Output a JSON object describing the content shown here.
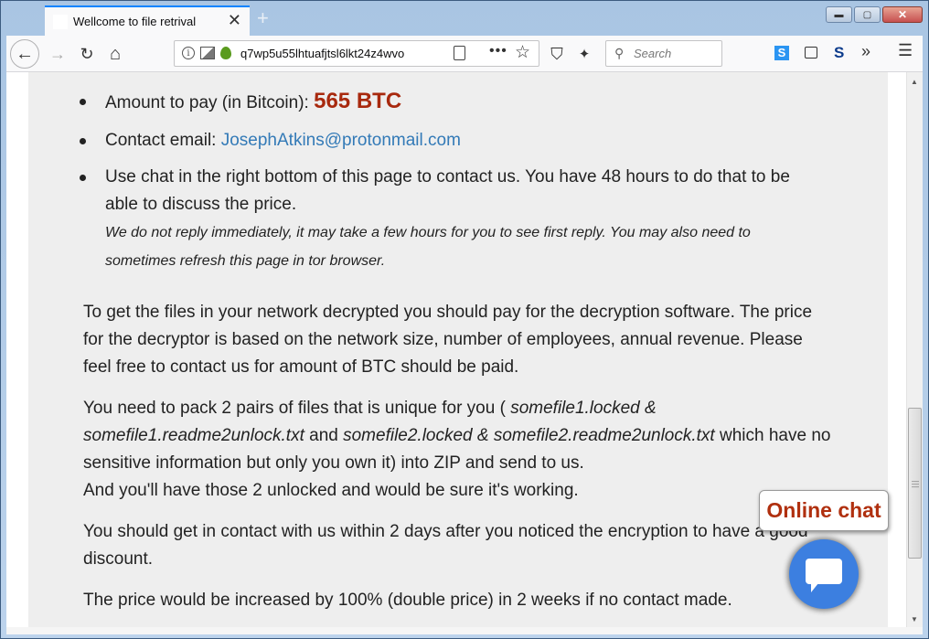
{
  "browser": {
    "tab_title": "Wellcome to file retrival",
    "tab_close": "✕",
    "new_tab": "+",
    "url": "q7wp5u55lhtuafjtsl6lkt24z4wvo",
    "search_placeholder": "Search",
    "window_buttons": {
      "minimize": "▬",
      "maximize": "▢",
      "close": "✕"
    },
    "icons": {
      "back": "←",
      "forward": "→",
      "reload": "↻",
      "home": "⌂",
      "more": "•••",
      "star": "☆",
      "shield": "⛉",
      "magic": "✦",
      "search": "⚲",
      "s1": "S",
      "s2": "S",
      "overflow": "»",
      "menu": "☰",
      "info": "i"
    }
  },
  "page": {
    "bullets": {
      "amount_label": "Amount to pay (in Bitcoin): ",
      "amount_value": "565 BTC",
      "email_label": "Contact email: ",
      "email_value": "JosephAtkins@protonmail.com",
      "chat_text": "Use chat in the right bottom of this page to contact us. You have 48 hours to do that to be able to discuss the price.",
      "chat_note": "We do not reply immediately, it may take a few hours for you to see first reply. You may also need to sometimes refresh this page in tor browser."
    },
    "paragraphs": {
      "p1": "To get the files in your network decrypted you should pay for the decryption software. The price for the decryptor is based on the network size, number of employees, annual revenue. Please feel free to contact us for amount of BTC should be paid.",
      "p2_a": "You need to pack 2 pairs of files that is unique for you ( ",
      "p2_f1": "somefile1.locked & somefile1.readme2unlock.txt",
      "p2_and": " and ",
      "p2_f2": "somefile2.locked & somefile2.readme2unlock.txt",
      "p2_b": " which have no sensitive information but only you own it) into ZIP and send to us.",
      "p2_c": "And you'll have those 2 unlocked and would be sure it's working.",
      "p3": "You should get in contact with us within 2 days after you noticed the encryption to have a good discount.",
      "p4": "The price would be increased by 100% (double price) in 2 weeks if no contact made."
    },
    "chat": {
      "label": "Online chat"
    }
  },
  "colors": {
    "amount": "#a8290e",
    "link": "#337ab7",
    "chat_button": "#3c7fe0",
    "chat_label": "#b0300f",
    "content_bg": "#eeeeee"
  }
}
